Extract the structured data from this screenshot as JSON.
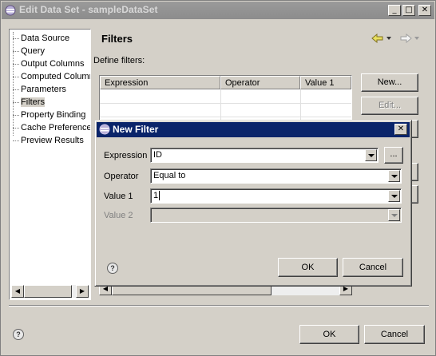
{
  "window": {
    "title": "Edit Data Set - sampleDataSet",
    "controls": {
      "minimize": "_",
      "maximize": "□",
      "close": "✕"
    }
  },
  "nav": {
    "items": [
      {
        "label": "Data Source"
      },
      {
        "label": "Query"
      },
      {
        "label": "Output Columns"
      },
      {
        "label": "Computed Columns"
      },
      {
        "label": "Parameters"
      },
      {
        "label": "Filters"
      },
      {
        "label": "Property Binding"
      },
      {
        "label": "Cache Preference"
      },
      {
        "label": "Preview Results"
      }
    ],
    "selected": "Filters"
  },
  "page": {
    "title": "Filters",
    "define_label": "Define filters:",
    "table_headers": [
      "Expression",
      "Operator",
      "Value 1"
    ],
    "buttons": {
      "new": "New...",
      "edit": "Edit..."
    }
  },
  "dialog": {
    "title": "New Filter",
    "close": "✕",
    "fields": {
      "expression": {
        "label": "Expression",
        "value": "ID",
        "button": "..."
      },
      "operator": {
        "label": "Operator",
        "value": "Equal to"
      },
      "value1": {
        "label": "Value 1",
        "value": "1"
      },
      "value2": {
        "label": "Value 2",
        "value": ""
      }
    },
    "ok": "OK",
    "cancel": "Cancel",
    "help": "?"
  },
  "footer": {
    "ok": "OK",
    "cancel": "Cancel",
    "help": "?"
  },
  "colors": {
    "dialog_titlebar": "#0a246a",
    "window_titlebar_inactive": "#8c8c8c",
    "face": "#d4d0c8"
  },
  "icons": {
    "window": "eclipse-icon",
    "back": "back-arrow-icon",
    "forward": "forward-arrow-icon"
  }
}
